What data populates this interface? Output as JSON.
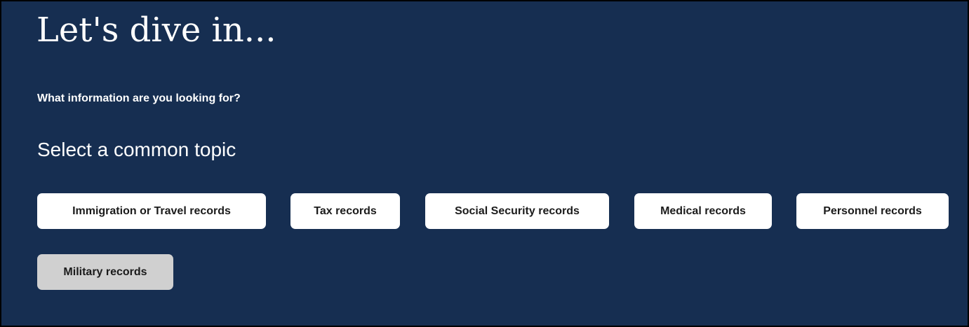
{
  "intro": {
    "heading": "Let's dive in...",
    "question": "What information are you looking for?"
  },
  "topics": {
    "heading": "Select a common topic",
    "selected": "Military records",
    "items": [
      {
        "label": "Immigration or Travel records"
      },
      {
        "label": "Tax records"
      },
      {
        "label": "Social Security records"
      },
      {
        "label": "Medical records"
      },
      {
        "label": "Personnel records"
      },
      {
        "label": "Military records"
      }
    ]
  },
  "colors": {
    "background": "#162e51",
    "button_bg": "#ffffff",
    "button_selected_bg": "#d0d0d0",
    "button_text": "#1b1b1b",
    "text": "#ffffff"
  }
}
